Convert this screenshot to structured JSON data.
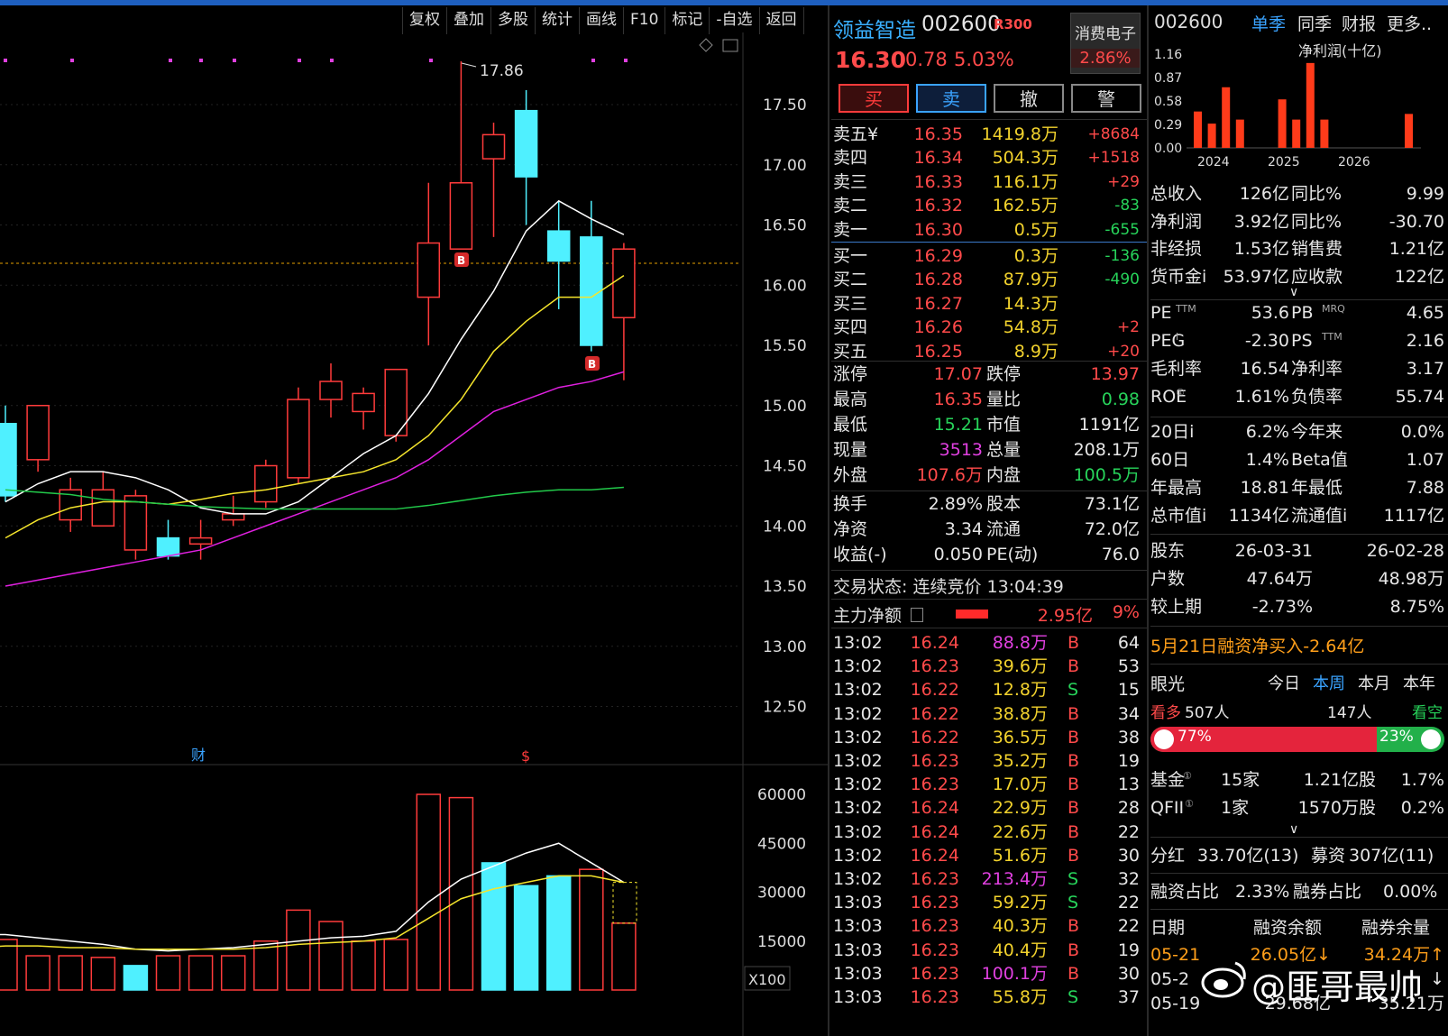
{
  "toolbar": [
    "复权",
    "叠加",
    "多股",
    "统计",
    "画线",
    "F10",
    "标记",
    "-自选",
    "返回"
  ],
  "chart": {
    "price_axis": [
      "17.50",
      "17.00",
      "16.50",
      "16.00",
      "15.50",
      "15.00",
      "14.50",
      "14.00",
      "13.50",
      "13.00",
      "12.50"
    ],
    "vol_axis": [
      "60000",
      "45000",
      "30000",
      "15000"
    ],
    "vol_unit": "X100",
    "high_label": "17.86",
    "marker_b": "B",
    "marker_cai": "财",
    "marker_s": "$",
    "candles": [
      {
        "o": 14.85,
        "h": 15.0,
        "l": 14.2,
        "c": 14.25
      },
      {
        "o": 14.55,
        "h": 15.0,
        "l": 14.45,
        "c": 15.0
      },
      {
        "o": 14.05,
        "h": 14.4,
        "l": 13.95,
        "c": 14.3
      },
      {
        "o": 14.0,
        "h": 14.45,
        "l": 14.0,
        "c": 14.3
      },
      {
        "o": 13.8,
        "h": 14.3,
        "l": 13.72,
        "c": 14.25
      },
      {
        "o": 13.9,
        "h": 14.05,
        "l": 13.72,
        "c": 13.75
      },
      {
        "o": 13.85,
        "h": 14.05,
        "l": 13.72,
        "c": 13.9
      },
      {
        "o": 14.05,
        "h": 14.25,
        "l": 14.0,
        "c": 14.1
      },
      {
        "o": 14.2,
        "h": 14.55,
        "l": 14.15,
        "c": 14.5
      },
      {
        "o": 14.4,
        "h": 15.15,
        "l": 14.35,
        "c": 15.05
      },
      {
        "o": 15.05,
        "h": 15.35,
        "l": 14.9,
        "c": 15.2
      },
      {
        "o": 14.95,
        "h": 15.15,
        "l": 14.8,
        "c": 15.1
      },
      {
        "o": 14.75,
        "h": 15.25,
        "l": 14.7,
        "c": 15.3
      },
      {
        "o": 15.9,
        "h": 16.85,
        "l": 15.5,
        "c": 16.35
      },
      {
        "o": 16.3,
        "h": 17.86,
        "l": 16.3,
        "c": 16.85
      },
      {
        "o": 17.05,
        "h": 17.35,
        "l": 16.4,
        "c": 17.25
      },
      {
        "o": 17.45,
        "h": 17.62,
        "l": 16.5,
        "c": 16.9
      },
      {
        "o": 16.45,
        "h": 16.7,
        "l": 15.8,
        "c": 16.2
      },
      {
        "o": 16.4,
        "h": 16.7,
        "l": 15.45,
        "c": 15.5
      },
      {
        "o": 15.73,
        "h": 16.35,
        "l": 15.21,
        "c": 16.3
      }
    ],
    "ma": {
      "white": [
        14.2,
        14.35,
        14.45,
        14.45,
        14.4,
        14.3,
        14.15,
        14.1,
        14.1,
        14.2,
        14.4,
        14.6,
        14.75,
        15.1,
        15.55,
        15.95,
        16.45,
        16.7,
        16.55,
        16.42
      ],
      "yellow": [
        13.9,
        14.05,
        14.15,
        14.2,
        14.2,
        14.18,
        14.22,
        14.27,
        14.3,
        14.35,
        14.4,
        14.45,
        14.55,
        14.75,
        15.05,
        15.45,
        15.7,
        15.9,
        15.9,
        16.08
      ],
      "magenta": [
        13.5,
        13.55,
        13.6,
        13.65,
        13.7,
        13.75,
        13.8,
        13.9,
        14.0,
        14.1,
        14.2,
        14.3,
        14.4,
        14.55,
        14.75,
        14.95,
        15.05,
        15.15,
        15.2,
        15.28
      ],
      "green": [
        14.3,
        14.28,
        14.26,
        14.22,
        14.2,
        14.18,
        14.16,
        14.15,
        14.14,
        14.14,
        14.14,
        14.14,
        14.14,
        14.17,
        14.21,
        14.25,
        14.28,
        14.3,
        14.3,
        14.32
      ]
    },
    "volumes": [
      20000,
      15500,
      10500,
      10500,
      10000,
      7500,
      10500,
      10500,
      10500,
      15000,
      24500,
      21000,
      15000,
      15500,
      60000,
      59000,
      39000,
      32000,
      35000,
      37000,
      20500
    ],
    "vol_ma_white": [
      17000,
      17000,
      16000,
      15000,
      14000,
      12500,
      12000,
      12500,
      13000,
      14000,
      15000,
      16000,
      16500,
      18000,
      27000,
      34000,
      38000,
      42000,
      45000,
      39000,
      33000
    ],
    "vol_ma_yellow": [
      13000,
      13500,
      13500,
      13000,
      13000,
      12500,
      12500,
      12500,
      12500,
      13000,
      14000,
      14500,
      15000,
      16000,
      22000,
      28000,
      31000,
      33000,
      35000,
      35000,
      33000
    ]
  },
  "quote": {
    "name": "领益智造",
    "code": "002600",
    "index_tag": "R300",
    "sector": "消费电子",
    "sector_chg": "2.86%",
    "price": "16.30",
    "change": "0.78",
    "change_pct": "5.03%",
    "buttons": [
      "买",
      "卖",
      "撤",
      "警"
    ],
    "asks": [
      {
        "label": "卖五¥",
        "price": "16.35",
        "vol": "1419.8万",
        "chg": "+8684"
      },
      {
        "label": "卖四",
        "price": "16.34",
        "vol": "504.3万",
        "chg": "+1518"
      },
      {
        "label": "卖三",
        "price": "16.33",
        "vol": "116.1万",
        "chg": "+29"
      },
      {
        "label": "卖二",
        "price": "16.32",
        "vol": "162.5万",
        "chg": "-83"
      },
      {
        "label": "卖一",
        "price": "16.30",
        "vol": "0.5万",
        "chg": "-655"
      }
    ],
    "bids": [
      {
        "label": "买一",
        "price": "16.29",
        "vol": "0.3万",
        "chg": "-136"
      },
      {
        "label": "买二",
        "price": "16.28",
        "vol": "87.9万",
        "chg": "-490"
      },
      {
        "label": "买三",
        "price": "16.27",
        "vol": "14.3万",
        "chg": ""
      },
      {
        "label": "买四",
        "price": "16.26",
        "vol": "54.8万",
        "chg": "+2"
      },
      {
        "label": "买五",
        "price": "16.25",
        "vol": "8.9万",
        "chg": "+20"
      }
    ],
    "stats": [
      {
        "l1": "涨停",
        "v1": "17.07",
        "l2": "跌停",
        "v2": "13.97"
      },
      {
        "l1": "最高",
        "v1": "16.35",
        "l2": "量比",
        "v2": "0.98"
      },
      {
        "l1": "最低",
        "v1": "15.21",
        "l2": "市值",
        "v2": "1191亿"
      },
      {
        "l1": "现量",
        "v1": "3513",
        "l2": "总量",
        "v2": "208.1万"
      },
      {
        "l1": "外盘",
        "v1": "107.6万",
        "l2": "内盘",
        "v2": "100.5万"
      }
    ],
    "stats2": [
      {
        "l1": "换手",
        "v1": "2.89%",
        "l2": "股本",
        "v2": "73.1亿"
      },
      {
        "l1": "净资",
        "v1": "3.34",
        "l2": "流通",
        "v2": "72.0亿"
      },
      {
        "l1": "收益(-)",
        "v1": "0.050",
        "l2": "PE(动)",
        "v2": "76.0"
      }
    ],
    "trade_status": "交易状态: 连续竞价 13:04:39",
    "main_flow": {
      "label": "主力净额",
      "value": "2.95亿",
      "pct": "9%"
    },
    "ticks": [
      {
        "t": "13:02",
        "p": "16.24",
        "v": "88.8万",
        "s": "B",
        "n": "64"
      },
      {
        "t": "13:02",
        "p": "16.23",
        "v": "39.6万",
        "s": "B",
        "n": "53"
      },
      {
        "t": "13:02",
        "p": "16.22",
        "v": "12.8万",
        "s": "S",
        "n": "15"
      },
      {
        "t": "13:02",
        "p": "16.22",
        "v": "38.8万",
        "s": "B",
        "n": "34"
      },
      {
        "t": "13:02",
        "p": "16.22",
        "v": "36.5万",
        "s": "B",
        "n": "38"
      },
      {
        "t": "13:02",
        "p": "16.23",
        "v": "35.2万",
        "s": "B",
        "n": "19"
      },
      {
        "t": "13:02",
        "p": "16.23",
        "v": "17.0万",
        "s": "B",
        "n": "13"
      },
      {
        "t": "13:02",
        "p": "16.24",
        "v": "22.9万",
        "s": "B",
        "n": "28"
      },
      {
        "t": "13:02",
        "p": "16.24",
        "v": "22.6万",
        "s": "B",
        "n": "22"
      },
      {
        "t": "13:02",
        "p": "16.24",
        "v": "51.6万",
        "s": "B",
        "n": "30"
      },
      {
        "t": "13:02",
        "p": "16.23",
        "v": "213.4万",
        "s": "S",
        "n": "32"
      },
      {
        "t": "13:03",
        "p": "16.23",
        "v": "59.2万",
        "s": "S",
        "n": "22"
      },
      {
        "t": "13:03",
        "p": "16.23",
        "v": "40.3万",
        "s": "B",
        "n": "22"
      },
      {
        "t": "13:03",
        "p": "16.23",
        "v": "40.4万",
        "s": "B",
        "n": "19"
      },
      {
        "t": "13:03",
        "p": "16.23",
        "v": "100.1万",
        "s": "B",
        "n": "30"
      },
      {
        "t": "13:03",
        "p": "16.23",
        "v": "55.8万",
        "s": "S",
        "n": "37"
      }
    ]
  },
  "fin": {
    "code": "002600",
    "tabs": [
      "单季",
      "同季",
      "财报",
      "更多.."
    ],
    "mini_title": "净利润(十亿)",
    "mini_y": [
      "1.16",
      "0.87",
      "0.58",
      "0.29",
      "0.00"
    ],
    "mini_x": [
      "2024",
      "2025",
      "2026"
    ],
    "mini_bars": [
      0.45,
      0.3,
      0.75,
      0.35,
      0.0,
      0.0,
      0.6,
      0.35,
      1.05,
      0.35,
      0.0,
      0.0,
      0.0,
      0.0,
      0.0,
      0.42
    ],
    "rows1": [
      {
        "l1": "总收入",
        "v1": "126亿",
        "l2": "同比%",
        "v2": "9.99"
      },
      {
        "l1": "净利润",
        "v1": "3.92亿",
        "l2": "同比%",
        "v2": "-30.70"
      },
      {
        "l1": "非经损",
        "v1": "1.53亿",
        "l2": "销售费",
        "v2": "1.21亿"
      },
      {
        "l1": "货币金i",
        "v1": "53.97亿",
        "l2": "应收款",
        "v2": "122亿"
      }
    ],
    "rows2": [
      {
        "l1": "PE",
        "s1": "TTM",
        "v1": "53.6",
        "l2": "PB",
        "s2": "MRQ",
        "v2": "4.65"
      },
      {
        "l1": "PEG",
        "s1": "i",
        "v1": "-2.30",
        "l2": "PS",
        "s2": "TTM",
        "v2": "2.16"
      },
      {
        "l1": "毛利率",
        "s1": "",
        "v1": "16.54",
        "l2": "净利率",
        "s2": "",
        "v2": "3.17"
      },
      {
        "l1": "ROE",
        "s1": "①",
        "v1": "1.61%",
        "l2": "负债率",
        "s2": "",
        "v2": "55.74"
      }
    ],
    "rows3": [
      {
        "l1": "20日i",
        "v1": "6.2%",
        "l2": "今年来",
        "v2": "0.0%"
      },
      {
        "l1": "60日",
        "v1": "1.4%",
        "l2": "Beta值",
        "v2": "1.07"
      },
      {
        "l1": "年最高",
        "v1": "18.81",
        "l2": "年最低",
        "v2": "7.88"
      },
      {
        "l1": "总市值i",
        "v1": "1134亿",
        "l2": "流通值i",
        "v2": "1117亿"
      }
    ],
    "holders": [
      {
        "l": "股东",
        "a": "26-03-31",
        "b": "26-02-28"
      },
      {
        "l": "户数",
        "a": "47.64万",
        "b": "48.98万"
      },
      {
        "l": "较上期",
        "a": "-2.73%",
        "b": "8.75%"
      }
    ],
    "margin_note": "5月21日融资净买入-2.64亿",
    "eye": {
      "label": "眼光",
      "tabs": [
        "今日",
        "本周",
        "本月",
        "本年"
      ],
      "bull_label": "看多",
      "bull_count": "507人",
      "bear_count": "147人",
      "bear_label": "看空",
      "bull_pct": "77%",
      "bear_pct": "23%",
      "bull_frac": 0.77
    },
    "funds": [
      {
        "l": "基金",
        "s": "①",
        "a": "15家",
        "b": "1.21亿股",
        "c": "1.7%"
      },
      {
        "l": "QFII",
        "s": "①",
        "a": "1家",
        "b": "1570万股",
        "c": "0.2%"
      }
    ],
    "dividend": {
      "l": "分红",
      "v": "33.70亿(13)",
      "l2": "募资",
      "v2": "307亿(11)"
    },
    "ratio": {
      "l": "融资占比",
      "v": "2.33%",
      "l2": "融券占比",
      "v2": "0.00%"
    },
    "mtable_head": [
      "日期",
      "融资余额",
      "融券余量"
    ],
    "mtable": [
      {
        "d": "05-21",
        "a": "26.05亿↓",
        "b": "34.24万↑"
      },
      {
        "d": "05-2",
        "a": "",
        "b": "↓"
      },
      {
        "d": "05-19",
        "a": "29.68亿",
        "b": "35.21万"
      }
    ],
    "watermark": "@匪哥最帅"
  }
}
